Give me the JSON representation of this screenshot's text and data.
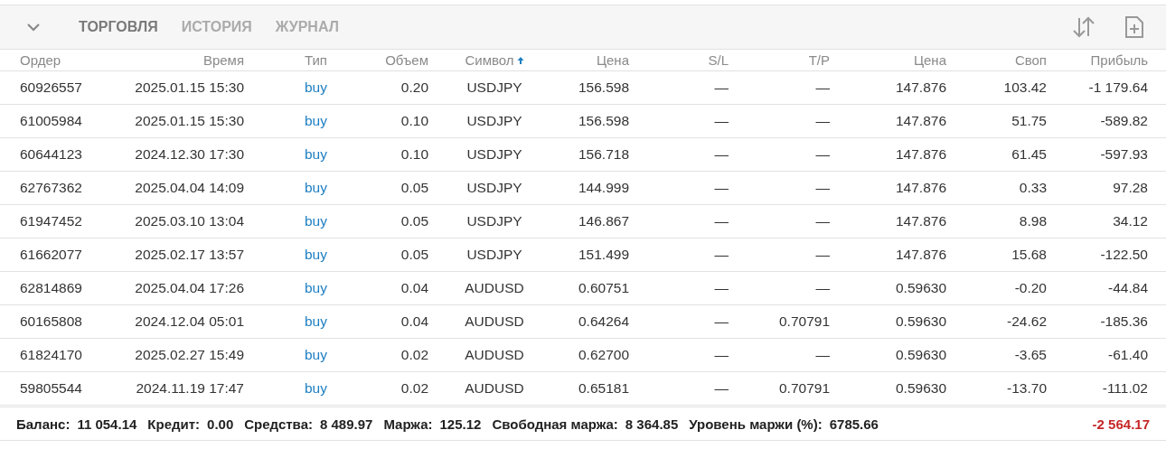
{
  "tabs": [
    {
      "label": "ТОРГОВЛЯ",
      "selected": true
    },
    {
      "label": "ИСТОРИЯ",
      "selected": false
    },
    {
      "label": "ЖУРНАЛ",
      "selected": false
    }
  ],
  "table": {
    "columns": [
      {
        "label": "Ордер",
        "sorted": false
      },
      {
        "label": "Время",
        "sorted": false
      },
      {
        "label": "Тип",
        "sorted": false
      },
      {
        "label": "Объем",
        "sorted": false
      },
      {
        "label": "Символ",
        "sorted": true
      },
      {
        "label": "Цена",
        "sorted": false
      },
      {
        "label": "S/L",
        "sorted": false
      },
      {
        "label": "T/P",
        "sorted": false
      },
      {
        "label": "Цена",
        "sorted": false
      },
      {
        "label": "Своп",
        "sorted": false
      },
      {
        "label": "Прибыль",
        "sorted": false
      }
    ],
    "rows": [
      [
        "60926557",
        "2025.01.15 15:30",
        "buy",
        "0.20",
        "USDJPY",
        "156.598",
        "—",
        "—",
        "147.876",
        "103.42",
        "-1 179.64"
      ],
      [
        "61005984",
        "2025.01.15 15:30",
        "buy",
        "0.10",
        "USDJPY",
        "156.598",
        "—",
        "—",
        "147.876",
        "51.75",
        "-589.82"
      ],
      [
        "60644123",
        "2024.12.30 17:30",
        "buy",
        "0.10",
        "USDJPY",
        "156.718",
        "—",
        "—",
        "147.876",
        "61.45",
        "-597.93"
      ],
      [
        "62767362",
        "2025.04.04 14:09",
        "buy",
        "0.05",
        "USDJPY",
        "144.999",
        "—",
        "—",
        "147.876",
        "0.33",
        "97.28"
      ],
      [
        "61947452",
        "2025.03.10 13:04",
        "buy",
        "0.05",
        "USDJPY",
        "146.867",
        "—",
        "—",
        "147.876",
        "8.98",
        "34.12"
      ],
      [
        "61662077",
        "2025.02.17 13:57",
        "buy",
        "0.05",
        "USDJPY",
        "151.499",
        "—",
        "—",
        "147.876",
        "15.68",
        "-122.50"
      ],
      [
        "62814869",
        "2025.04.04 17:26",
        "buy",
        "0.04",
        "AUDUSD",
        "0.60751",
        "—",
        "—",
        "0.59630",
        "-0.20",
        "-44.84"
      ],
      [
        "60165808",
        "2024.12.04 05:01",
        "buy",
        "0.04",
        "AUDUSD",
        "0.64264",
        "—",
        "0.70791",
        "0.59630",
        "-24.62",
        "-185.36"
      ],
      [
        "61824170",
        "2025.02.27 15:49",
        "buy",
        "0.02",
        "AUDUSD",
        "0.62700",
        "—",
        "—",
        "0.59630",
        "-3.65",
        "-61.40"
      ],
      [
        "59805544",
        "2024.11.19 17:47",
        "buy",
        "0.02",
        "AUDUSD",
        "0.65181",
        "—",
        "0.70791",
        "0.59630",
        "-13.70",
        "-111.02"
      ]
    ]
  },
  "summary": {
    "items": [
      {
        "label": "Баланс:",
        "value": "11 054.14"
      },
      {
        "label": "Кредит:",
        "value": "0.00"
      },
      {
        "label": "Средства:",
        "value": "8 489.97"
      },
      {
        "label": "Маржа:",
        "value": "125.12"
      },
      {
        "label": "Свободная маржа:",
        "value": "8 364.85"
      },
      {
        "label": "Уровень маржи (%):",
        "value": "6785.66"
      }
    ],
    "total": "-2 564.17"
  }
}
